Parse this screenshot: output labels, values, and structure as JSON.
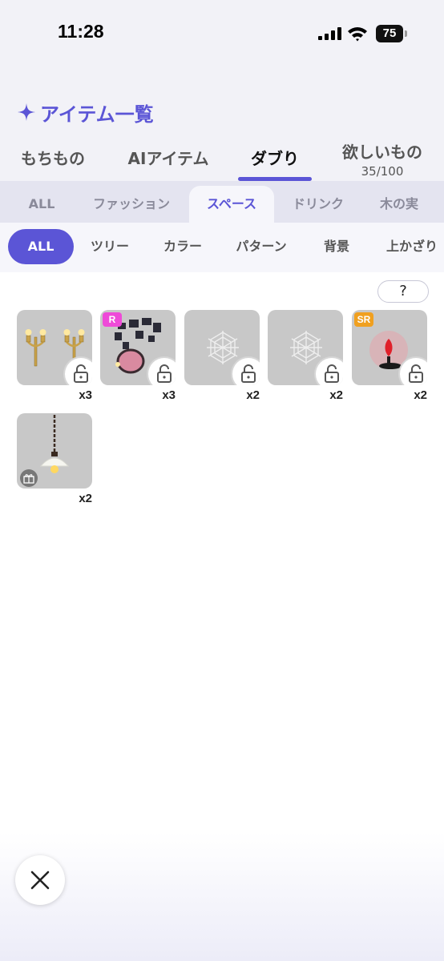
{
  "status_bar": {
    "time": "11:28",
    "battery": "75"
  },
  "header": {
    "title": "アイテム一覧"
  },
  "main_tabs": [
    {
      "label": "もちもの"
    },
    {
      "label": "AIアイテム"
    },
    {
      "label": "ダブり",
      "active": true
    },
    {
      "label": "欲しいもの",
      "sub": "35/100"
    }
  ],
  "category_tabs": [
    {
      "label": "ALL"
    },
    {
      "label": "ファッション"
    },
    {
      "label": "スペース",
      "active": true
    },
    {
      "label": "ドリンク"
    },
    {
      "label": "木の実"
    }
  ],
  "filter_chips": [
    {
      "label": "ALL",
      "active": true
    },
    {
      "label": "ツリー"
    },
    {
      "label": "カラー"
    },
    {
      "label": "パターン"
    },
    {
      "label": "背景"
    },
    {
      "label": "上かざり"
    }
  ],
  "help": {
    "label": "?"
  },
  "items": [
    {
      "name": "candelabra-pair",
      "count": "x3"
    },
    {
      "name": "wall-frames",
      "rarity": "R",
      "count": "x3"
    },
    {
      "name": "spider-web",
      "count": "x2"
    },
    {
      "name": "spider-web",
      "count": "x2"
    },
    {
      "name": "red-candle",
      "rarity": "SR",
      "count": "x2"
    },
    {
      "name": "pendant-lamp",
      "count": "x2"
    }
  ],
  "colors": {
    "accent": "#5b55d6",
    "rarity_r": "#ee4ad8",
    "rarity_sr": "#f0a020"
  }
}
